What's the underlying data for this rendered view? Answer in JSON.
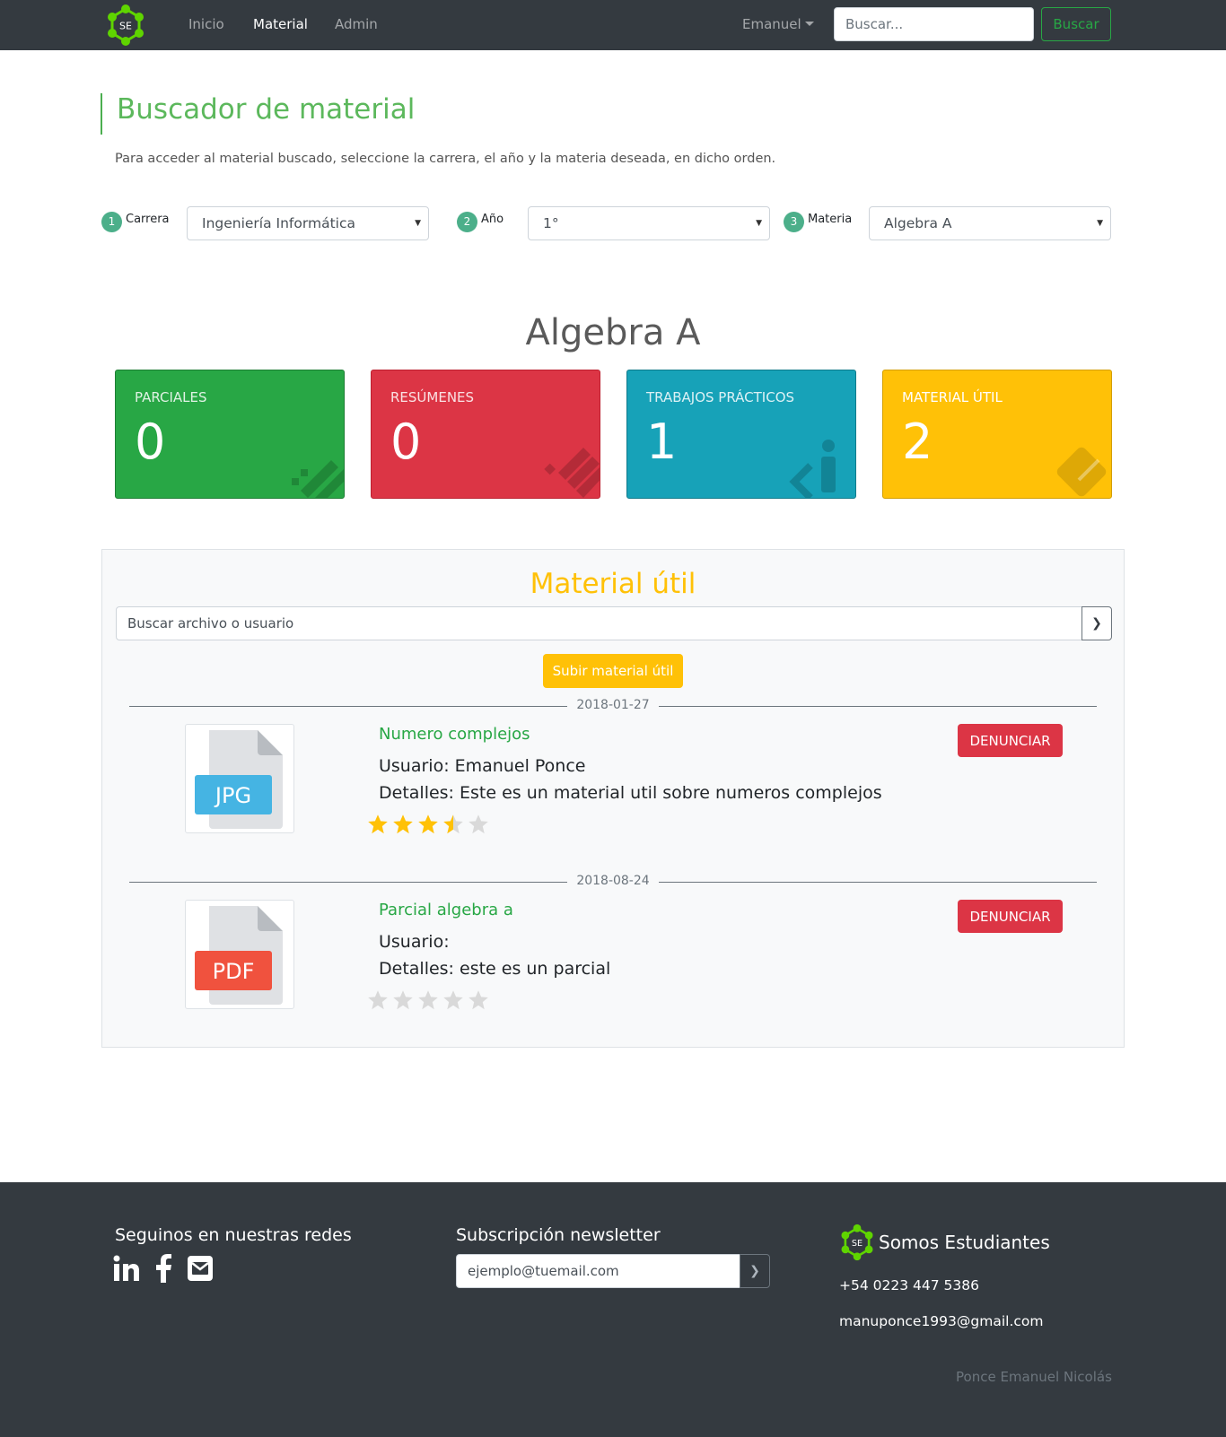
{
  "nav": {
    "logo_text": "SE",
    "links": [
      "Inicio",
      "Material",
      "Admin"
    ],
    "user": "Emanuel",
    "search_placeholder": "Buscar...",
    "search_button": "Buscar"
  },
  "header": {
    "title": "Buscador de material",
    "description": "Para acceder al material buscado, seleccione la carrera, el año y la materia deseada, en dicho orden."
  },
  "filters": [
    {
      "num": "1",
      "label": "Carrera",
      "value": "Ingeniería Informática"
    },
    {
      "num": "2",
      "label": "Año",
      "value": "1°"
    },
    {
      "num": "3",
      "label": "Materia",
      "value": "Algebra A"
    }
  ],
  "subject": "Algebra A",
  "cards": [
    {
      "label": "PARCIALES",
      "count": "0",
      "icon": "pencil-ruler-icon"
    },
    {
      "label": "RESÚMENES",
      "count": "0",
      "icon": "list-icon"
    },
    {
      "label": "TRABAJOS PRÁCTICOS",
      "count": "1",
      "icon": "code-info-icon"
    },
    {
      "label": "MATERIAL ÚTIL",
      "count": "2",
      "icon": "book-icon"
    }
  ],
  "panel": {
    "title": "Material útil",
    "search_placeholder": "Buscar archivo o usuario",
    "upload_button": "Subir material útil",
    "report_button": "DENUNCIAR",
    "items": [
      {
        "date": "2018-01-27",
        "file_type": "JPG",
        "title": "Numero complejos",
        "user": "Usuario: Emanuel Ponce",
        "details": "Detalles: Este es un material util sobre numeros complejos",
        "rating": 3.5
      },
      {
        "date": "2018-08-24",
        "file_type": "PDF",
        "title": "Parcial algebra a",
        "user": "Usuario:",
        "details": "Detalles: este es un parcial",
        "rating": 0
      }
    ]
  },
  "footer": {
    "social_title": "Seguinos en nuestras redes",
    "newsletter_title": "Subscripción newsletter",
    "newsletter_placeholder": "ejemplo@tuemail.com",
    "brand": "Somos Estudiantes",
    "phone": "+54 0223 447 5386",
    "email": "manuponce1993@gmail.com",
    "credit": "Ponce Emanuel Nicolás"
  },
  "colors": {
    "green": "#28a745",
    "red": "#dc3545",
    "cyan": "#17a2b8",
    "yellow": "#ffc107",
    "dark": "#343a40"
  }
}
